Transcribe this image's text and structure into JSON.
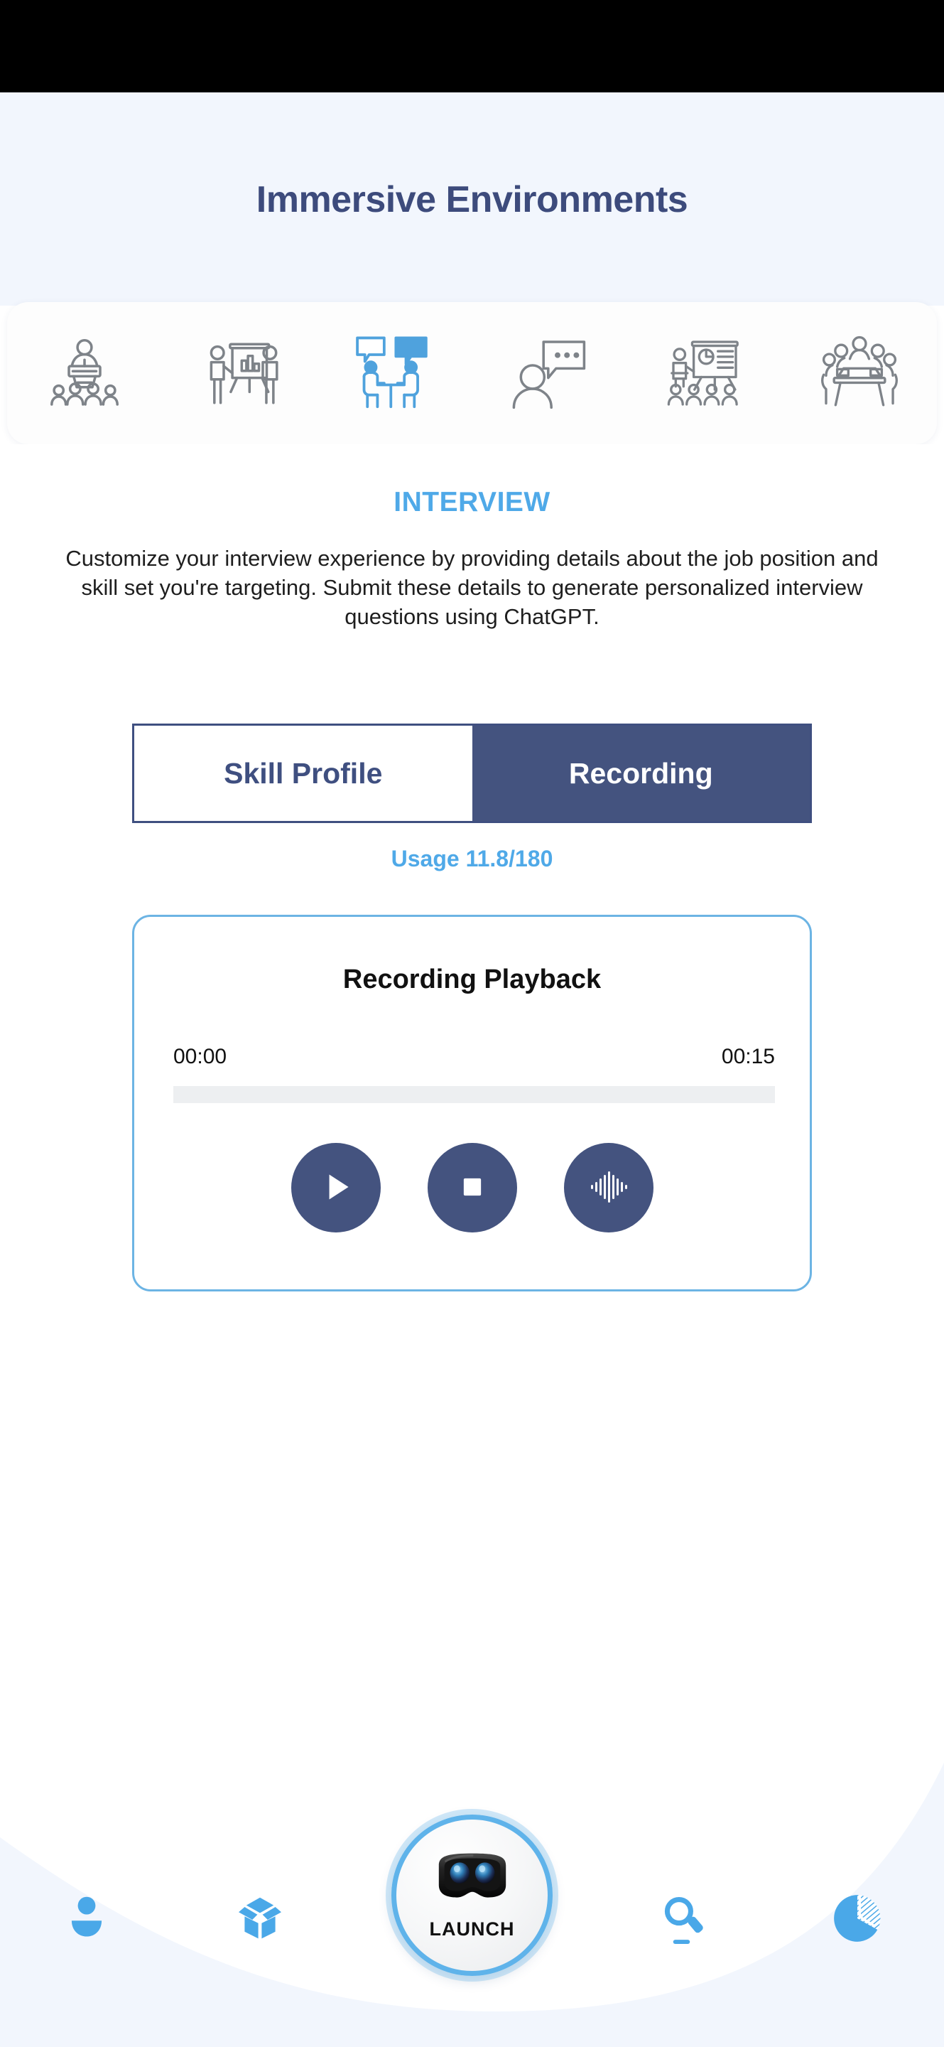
{
  "status_bar": {
    "visible": true
  },
  "header": {
    "title": "Immersive Environments"
  },
  "environments": {
    "items": [
      {
        "icon": "podium-audience-icon",
        "name": "public-speaking",
        "active": false
      },
      {
        "icon": "presentation-easel-icon",
        "name": "presentation",
        "active": false
      },
      {
        "icon": "interview-table-chat-icon",
        "name": "interview",
        "active": true
      },
      {
        "icon": "person-speech-bubble-icon",
        "name": "conversation",
        "active": false
      },
      {
        "icon": "training-classroom-icon",
        "name": "training",
        "active": false
      },
      {
        "icon": "meeting-table-icon",
        "name": "meeting",
        "active": false
      }
    ],
    "active_index": 2
  },
  "section": {
    "label": "INTERVIEW",
    "description": "Customize your interview experience by providing details about the job position and skill set you're targeting. Submit these details to generate personalized interview questions using ChatGPT."
  },
  "tabs": {
    "items": [
      {
        "label": "Skill Profile",
        "active": false
      },
      {
        "label": "Recording",
        "active": true
      }
    ]
  },
  "usage": {
    "text": "Usage 11.8/180",
    "used": 11.8,
    "limit": 180
  },
  "playback": {
    "title": "Recording Playback",
    "current_time": "00:00",
    "total_time": "00:15",
    "progress_percent": 0,
    "controls": [
      {
        "name": "play-button",
        "icon": "play-icon"
      },
      {
        "name": "stop-button",
        "icon": "stop-icon"
      },
      {
        "name": "waveform-button",
        "icon": "waveform-icon"
      }
    ]
  },
  "bottom_nav": {
    "items": [
      {
        "name": "profile",
        "icon": "person-icon"
      },
      {
        "name": "packages",
        "icon": "open-box-icon"
      },
      {
        "name": "search",
        "icon": "search-icon"
      },
      {
        "name": "analytics",
        "icon": "pie-chart-icon"
      }
    ],
    "launch": {
      "label": "LAUNCH",
      "icon": "vr-headset-icon"
    }
  },
  "colors": {
    "page_bg": "#ffffff",
    "header_bg": "#f2f6fd",
    "title_navy": "#3d4b7c",
    "accent_blue": "#4fa9e8",
    "tab_active_bg": "#44537f",
    "card_border": "#6cb4e4",
    "control_bg": "#44537f",
    "progress_track": "#edeff1",
    "nav_icon_blue": "#4aa8e8"
  }
}
